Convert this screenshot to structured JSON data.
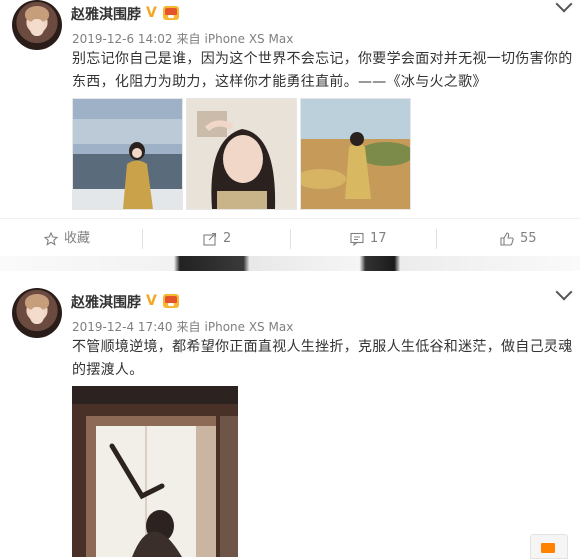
{
  "posts": [
    {
      "author": "赵雅淇围脖",
      "verified_badge": "V",
      "meta": {
        "time": "2019-12-6 14:02",
        "from": "来自",
        "device": "iPhone XS Max"
      },
      "content": "别忘记你自己是谁，因为这个世界不会忘记，你要学会面对并无视一切伤害你的东西，化阻力为助力，这样你才能勇往直前。——《冰与火之歌》",
      "images": [
        {
          "name": "photo-sea-yellow-coat",
          "colors": [
            "#9fb1c6",
            "#c9d3dd",
            "#5a6b7c",
            "#c9a24a"
          ]
        },
        {
          "name": "photo-selfie",
          "colors": [
            "#e8e2d8",
            "#b5a28c",
            "#2b2220",
            "#f0d7c7"
          ]
        },
        {
          "name": "photo-field",
          "colors": [
            "#bcd0dc",
            "#c69b5a",
            "#7d8b4a",
            "#d6b463"
          ]
        }
      ],
      "actions": {
        "favorite": "收藏",
        "repost": "2",
        "comment": "17",
        "like": "55"
      }
    },
    {
      "author": "赵雅淇围脖",
      "verified_badge": "V",
      "meta": {
        "time": "2019-12-4 17:40",
        "from": "来自",
        "device": "iPhone XS Max"
      },
      "content": "不管顺境逆境，都希望你正面直视人生挫折，克服人生低谷和迷茫，做自己灵魂的摆渡人。",
      "images": [
        {
          "name": "photo-window-pose",
          "colors": [
            "#4a3128",
            "#f2efe9",
            "#8c6a55",
            "#2c2220"
          ]
        }
      ]
    }
  ],
  "icons": {
    "favorite": "star-icon",
    "repost": "share-icon",
    "comment": "comment-icon",
    "like": "thumbs-up-icon",
    "more": "chevron-down-icon",
    "float": "envelope-icon"
  },
  "colors": {
    "accent_orange": "#ff8200",
    "badge_gold": "#f5a623",
    "meta_gray": "#808080"
  }
}
